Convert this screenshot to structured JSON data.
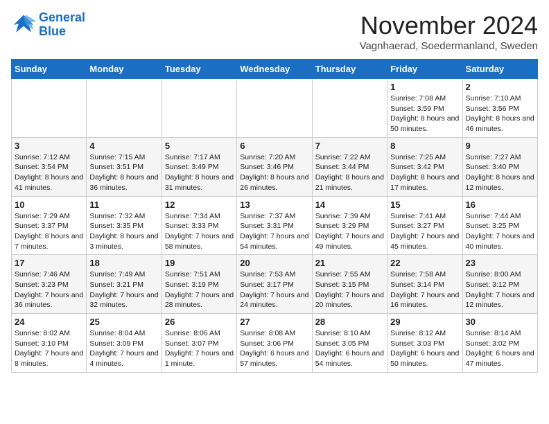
{
  "header": {
    "logo_line1": "General",
    "logo_line2": "Blue",
    "month_title": "November 2024",
    "location": "Vagnhaerad, Soedermanland, Sweden"
  },
  "weekdays": [
    "Sunday",
    "Monday",
    "Tuesday",
    "Wednesday",
    "Thursday",
    "Friday",
    "Saturday"
  ],
  "rows": [
    [
      {
        "day": "",
        "info": ""
      },
      {
        "day": "",
        "info": ""
      },
      {
        "day": "",
        "info": ""
      },
      {
        "day": "",
        "info": ""
      },
      {
        "day": "",
        "info": ""
      },
      {
        "day": "1",
        "info": "Sunrise: 7:08 AM\nSunset: 3:59 PM\nDaylight: 8 hours and 50 minutes."
      },
      {
        "day": "2",
        "info": "Sunrise: 7:10 AM\nSunset: 3:56 PM\nDaylight: 8 hours and 46 minutes."
      }
    ],
    [
      {
        "day": "3",
        "info": "Sunrise: 7:12 AM\nSunset: 3:54 PM\nDaylight: 8 hours and 41 minutes."
      },
      {
        "day": "4",
        "info": "Sunrise: 7:15 AM\nSunset: 3:51 PM\nDaylight: 8 hours and 36 minutes."
      },
      {
        "day": "5",
        "info": "Sunrise: 7:17 AM\nSunset: 3:49 PM\nDaylight: 8 hours and 31 minutes."
      },
      {
        "day": "6",
        "info": "Sunrise: 7:20 AM\nSunset: 3:46 PM\nDaylight: 8 hours and 26 minutes."
      },
      {
        "day": "7",
        "info": "Sunrise: 7:22 AM\nSunset: 3:44 PM\nDaylight: 8 hours and 21 minutes."
      },
      {
        "day": "8",
        "info": "Sunrise: 7:25 AM\nSunset: 3:42 PM\nDaylight: 8 hours and 17 minutes."
      },
      {
        "day": "9",
        "info": "Sunrise: 7:27 AM\nSunset: 3:40 PM\nDaylight: 8 hours and 12 minutes."
      }
    ],
    [
      {
        "day": "10",
        "info": "Sunrise: 7:29 AM\nSunset: 3:37 PM\nDaylight: 8 hours and 7 minutes."
      },
      {
        "day": "11",
        "info": "Sunrise: 7:32 AM\nSunset: 3:35 PM\nDaylight: 8 hours and 3 minutes."
      },
      {
        "day": "12",
        "info": "Sunrise: 7:34 AM\nSunset: 3:33 PM\nDaylight: 7 hours and 58 minutes."
      },
      {
        "day": "13",
        "info": "Sunrise: 7:37 AM\nSunset: 3:31 PM\nDaylight: 7 hours and 54 minutes."
      },
      {
        "day": "14",
        "info": "Sunrise: 7:39 AM\nSunset: 3:29 PM\nDaylight: 7 hours and 49 minutes."
      },
      {
        "day": "15",
        "info": "Sunrise: 7:41 AM\nSunset: 3:27 PM\nDaylight: 7 hours and 45 minutes."
      },
      {
        "day": "16",
        "info": "Sunrise: 7:44 AM\nSunset: 3:25 PM\nDaylight: 7 hours and 40 minutes."
      }
    ],
    [
      {
        "day": "17",
        "info": "Sunrise: 7:46 AM\nSunset: 3:23 PM\nDaylight: 7 hours and 36 minutes."
      },
      {
        "day": "18",
        "info": "Sunrise: 7:49 AM\nSunset: 3:21 PM\nDaylight: 7 hours and 32 minutes."
      },
      {
        "day": "19",
        "info": "Sunrise: 7:51 AM\nSunset: 3:19 PM\nDaylight: 7 hours and 28 minutes."
      },
      {
        "day": "20",
        "info": "Sunrise: 7:53 AM\nSunset: 3:17 PM\nDaylight: 7 hours and 24 minutes."
      },
      {
        "day": "21",
        "info": "Sunrise: 7:55 AM\nSunset: 3:15 PM\nDaylight: 7 hours and 20 minutes."
      },
      {
        "day": "22",
        "info": "Sunrise: 7:58 AM\nSunset: 3:14 PM\nDaylight: 7 hours and 16 minutes."
      },
      {
        "day": "23",
        "info": "Sunrise: 8:00 AM\nSunset: 3:12 PM\nDaylight: 7 hours and 12 minutes."
      }
    ],
    [
      {
        "day": "24",
        "info": "Sunrise: 8:02 AM\nSunset: 3:10 PM\nDaylight: 7 hours and 8 minutes."
      },
      {
        "day": "25",
        "info": "Sunrise: 8:04 AM\nSunset: 3:09 PM\nDaylight: 7 hours and 4 minutes."
      },
      {
        "day": "26",
        "info": "Sunrise: 8:06 AM\nSunset: 3:07 PM\nDaylight: 7 hours and 1 minute."
      },
      {
        "day": "27",
        "info": "Sunrise: 8:08 AM\nSunset: 3:06 PM\nDaylight: 6 hours and 57 minutes."
      },
      {
        "day": "28",
        "info": "Sunrise: 8:10 AM\nSunset: 3:05 PM\nDaylight: 6 hours and 54 minutes."
      },
      {
        "day": "29",
        "info": "Sunrise: 8:12 AM\nSunset: 3:03 PM\nDaylight: 6 hours and 50 minutes."
      },
      {
        "day": "30",
        "info": "Sunrise: 8:14 AM\nSunset: 3:02 PM\nDaylight: 6 hours and 47 minutes."
      }
    ]
  ]
}
